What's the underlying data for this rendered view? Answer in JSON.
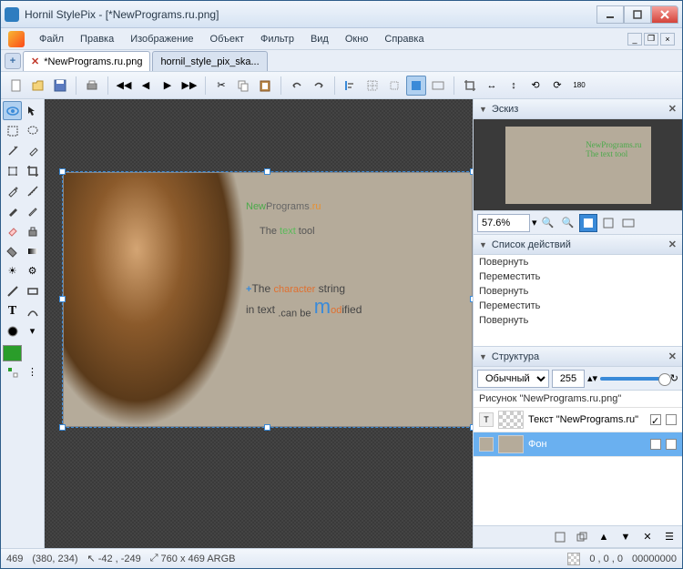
{
  "window": {
    "title": "Hornil StylePix - [*NewPrograms.ru.png]"
  },
  "menu": {
    "file": "Файл",
    "edit": "Правка",
    "image": "Изображение",
    "object": "Объект",
    "filter": "Фильтр",
    "view": "Вид",
    "window": "Окно",
    "help": "Справка"
  },
  "tabs": {
    "active": "*NewPrograms.ru.png",
    "inactive": "hornil_style_pix_ska..."
  },
  "panels": {
    "thumbnail": {
      "title": "Эскиз",
      "zoom": "57.6%"
    },
    "history": {
      "title": "Список действий",
      "items": [
        "Повернуть",
        "Переместить",
        "Повернуть",
        "Переместить",
        "Повернуть"
      ]
    },
    "structure": {
      "title": "Структура",
      "mode": "Обычный",
      "opacity": "255",
      "header": "Рисунок \"NewPrograms.ru.png\"",
      "layers": [
        {
          "type": "T",
          "name": "Текст \"NewPrograms.ru\""
        },
        {
          "type": "img",
          "name": "Фон"
        }
      ]
    }
  },
  "status": {
    "height": "469",
    "pos": "(380, 234)",
    "cursor_x": "-42",
    "cursor_y": "-249",
    "dims": "760 x 469 ARGB",
    "rgb": "0    , 0    , 0",
    "hex": "00000000"
  },
  "canvas": {
    "line1a": "New",
    "line1b": "Programs",
    "line1c": ".ru",
    "line2a": "The ",
    "line2b": "text",
    "line2c": " tool",
    "line3": "The character string in text can be modified"
  }
}
